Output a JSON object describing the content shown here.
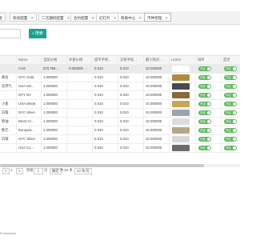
{
  "tabs": [
    {
      "label": "组",
      "active": false
    },
    {
      "label": "系统配置",
      "active": false
    },
    {
      "label": "二元期权配置",
      "active": false
    },
    {
      "label": "合约配置",
      "active": false
    },
    {
      "label": "幻灯片",
      "active": false
    },
    {
      "label": "帮助中心",
      "active": false
    },
    {
      "label": "币种管理",
      "active": true
    }
  ],
  "tab_close_glyph": "✕",
  "search": {
    "button_label": "搜索",
    "icon": "search-icon"
  },
  "table": {
    "columns": [
      "",
      "Name",
      "当前价格",
      "开盘价格",
      "提币手续...",
      "交易手续...",
      "最小购买...",
      "LOGO",
      "排序",
      "是否"
    ],
    "rows": [
      {
        "c0": "",
        "name": "CAS",
        "price": "570.756...",
        "open": "0.000000",
        "wd_fee": "0.010",
        "trade_fee": "0.010",
        "min_buy": "10.000000",
        "logo": "#ffffff",
        "sort_label": "开启",
        "status_label": "开启"
      },
      {
        "c0": "黄金",
        "name": "NYC Gold",
        "price": "1.000000",
        "open": "",
        "wd_fee": "0.010",
        "trade_fee": "0.010",
        "min_buy": "10.000000",
        "logo": "#b08a3e",
        "sort_label": "开启",
        "status_label": "开启"
      },
      {
        "c0": "天然气",
        "name": "USA nat...",
        "price": "1.000000",
        "open": "",
        "wd_fee": "0.010",
        "trade_fee": "0.010",
        "min_buy": "10.000000",
        "logo": "#4a4a4a",
        "sort_label": "开启",
        "status_label": "开启"
      },
      {
        "c0": "",
        "name": "NYY NY",
        "price": "1.000000",
        "open": "",
        "wd_fee": "0.010",
        "trade_fee": "0.010",
        "min_buy": "10.000000",
        "logo": "#8a6a3a",
        "sort_label": "开启",
        "status_label": "开启"
      },
      {
        "c0": "小麦",
        "name": "USA wheat",
        "price": "1.000000",
        "open": "",
        "wd_fee": "0.010",
        "trade_fee": "0.010",
        "min_buy": "10.000000",
        "logo": "#c9a55a",
        "sort_label": "开启",
        "status_label": "开启"
      },
      {
        "c0": "白银",
        "name": "NYC Silver",
        "price": "1.000000",
        "open": "",
        "wd_fee": "0.010",
        "trade_fee": "0.010",
        "min_buy": "10.000000",
        "logo": "#9aa4ad",
        "sort_label": "开启",
        "status_label": "开启"
      },
      {
        "c0": "原油",
        "name": "Brent Cr...",
        "price": "1.000000",
        "open": "",
        "wd_fee": "0.010",
        "trade_fee": "0.010",
        "min_buy": "10.000000",
        "logo": "#dcdcdc",
        "sort_label": "开启",
        "status_label": "开启"
      },
      {
        "c0": "欧元",
        "name": "Europea...",
        "price": "1.000000",
        "open": "",
        "wd_fee": "0.010",
        "trade_fee": "0.010",
        "min_buy": "10.000000",
        "logo": "#b7a58a",
        "sort_label": "开启",
        "status_label": "开启"
      },
      {
        "c0": "白银",
        "name": "NYC Silver",
        "price": "1.000000",
        "open": "",
        "wd_fee": "0.010",
        "trade_fee": "0.010",
        "min_buy": "10.000000",
        "logo": "#d8d8d8",
        "sort_label": "开启",
        "status_label": "开启"
      },
      {
        "c0": "",
        "name": "USA Co...",
        "price": "1.000000",
        "open": "",
        "wd_fee": "0.010",
        "trade_fee": "0.010",
        "min_buy": "10.000000",
        "logo": "#6a6a6a",
        "sort_label": "开启",
        "status_label": "开启"
      }
    ]
  },
  "pager": {
    "prev": "<",
    "page": "1",
    "next": ">",
    "goto_label": "到第",
    "page_unit": "页",
    "confirm": "确定",
    "total": "共 84 条",
    "per_page": "10 条/页"
  },
  "footer": "© reserved"
}
